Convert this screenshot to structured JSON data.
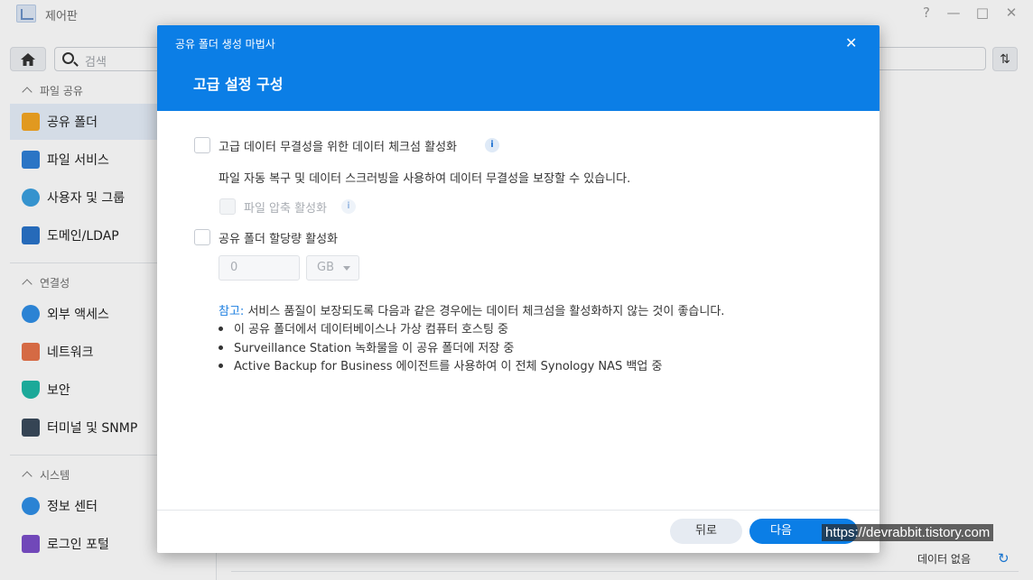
{
  "app": {
    "title": "제어판",
    "icon": "control-panel-icon",
    "window_controls": {
      "help": "?",
      "minimize": "—",
      "maximize": "□",
      "close": "✕"
    }
  },
  "toolbar": {
    "search_placeholder": "검색",
    "home_icon": "home-icon",
    "sort_icon": "sort-icon"
  },
  "sidebar": {
    "sections": [
      {
        "label": "파일 공유",
        "items": [
          {
            "label": "공유 폴더",
            "icon": "folder-icon",
            "active": true
          },
          {
            "label": "파일 서비스",
            "icon": "file-services-icon"
          },
          {
            "label": "사용자 및 그룹",
            "icon": "users-icon"
          },
          {
            "label": "도메인/LDAP",
            "icon": "domain-icon"
          }
        ]
      },
      {
        "label": "연결성",
        "items": [
          {
            "label": "외부 액세스",
            "icon": "external-access-icon"
          },
          {
            "label": "네트워크",
            "icon": "network-icon"
          },
          {
            "label": "보안",
            "icon": "shield-icon"
          },
          {
            "label": "터미널 및 SNMP",
            "icon": "terminal-icon"
          }
        ]
      },
      {
        "label": "시스템",
        "items": [
          {
            "label": "정보 센터",
            "icon": "info-center-icon"
          },
          {
            "label": "로그인 포털",
            "icon": "login-portal-icon"
          }
        ]
      }
    ]
  },
  "status": {
    "no_data": "데이터 없음"
  },
  "wizard": {
    "title": "공유 폴더 생성 마법사",
    "subtitle": "고급 설정 구성",
    "checksum": {
      "label": "고급 데이터 무결성을 위한 데이터 체크섬 활성화",
      "checked": false,
      "description": "파일 자동 복구 및 데이터 스크러빙을 사용하여 데이터 무결성을 보장할 수 있습니다."
    },
    "compression": {
      "label": "파일 압축 활성화",
      "checked": false,
      "disabled": true
    },
    "quota": {
      "label": "공유 폴더 할당량 활성화",
      "checked": false,
      "value": "0",
      "unit": "GB"
    },
    "note": {
      "prefix": "참고:",
      "text": " 서비스 품질이 보장되도록 다음과 같은 경우에는 데이터 체크섬을 활성화하지 않는 것이 좋습니다.",
      "bullets": [
        "이 공유 폴더에서 데이터베이스나 가상 컴퓨터 호스팅 중",
        "Surveillance Station 녹화물을 이 공유 폴더에 저장 중",
        "Active Backup for Business 에이전트를 사용하여 이 전체 Synology NAS 백업 중"
      ]
    },
    "buttons": {
      "back": "뒤로",
      "next": "다음"
    }
  },
  "watermark": "https://devrabbit.tistory.com"
}
